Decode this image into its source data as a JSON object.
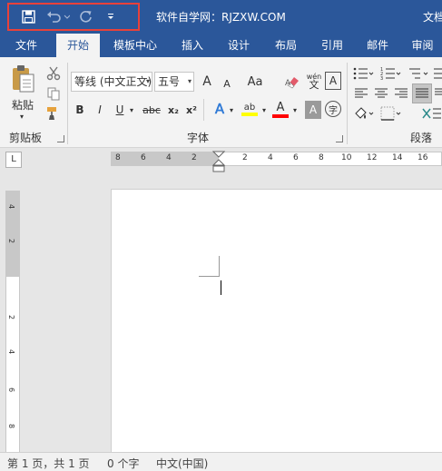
{
  "titlebar": {
    "title": "软件自学网：RJZXW.COM",
    "title_right": "文档",
    "qat": {
      "save": "save",
      "undo": "undo",
      "redo": "redo",
      "customize": "customize"
    }
  },
  "tabs": [
    {
      "label": "文件"
    },
    {
      "label": "开始"
    },
    {
      "label": "模板中心"
    },
    {
      "label": "插入"
    },
    {
      "label": "设计"
    },
    {
      "label": "布局"
    },
    {
      "label": "引用"
    },
    {
      "label": "邮件"
    },
    {
      "label": "审阅"
    }
  ],
  "ribbon": {
    "clipboard": {
      "paste": "粘贴",
      "label": "剪贴板"
    },
    "font": {
      "font_name": "等线 (中文正文)",
      "font_size": "五号",
      "grow": "A",
      "shrink": "A",
      "case": "Aa",
      "phonetic": "wén",
      "border_char": "A",
      "bold": "B",
      "italic": "I",
      "underline": "U",
      "strike": "abc",
      "subscript": "x₂",
      "superscript": "x²",
      "effects": "A",
      "highlight": "ab",
      "font_color": "A",
      "shading": "A",
      "enclose": "字",
      "label": "字体"
    },
    "paragraph": {
      "label": "段落"
    }
  },
  "ruler": {
    "h_left": [
      "8",
      "6",
      "4",
      "2"
    ],
    "h_right": [
      "2",
      "4",
      "6",
      "8",
      "10",
      "12",
      "14",
      "16"
    ],
    "v_top": [
      "4",
      "2"
    ],
    "v_bottom": [
      "2",
      "4",
      "6",
      "8"
    ],
    "tab_selector": "L"
  },
  "status": {
    "page": "第 1 页，共 1 页",
    "words": "0 个字",
    "language": "中文(中国)"
  },
  "colors": {
    "accent": "#2b579a",
    "highlight_box": "#e8413a",
    "highlight_yellow": "#ffff00",
    "font_red": "#ff0000"
  }
}
